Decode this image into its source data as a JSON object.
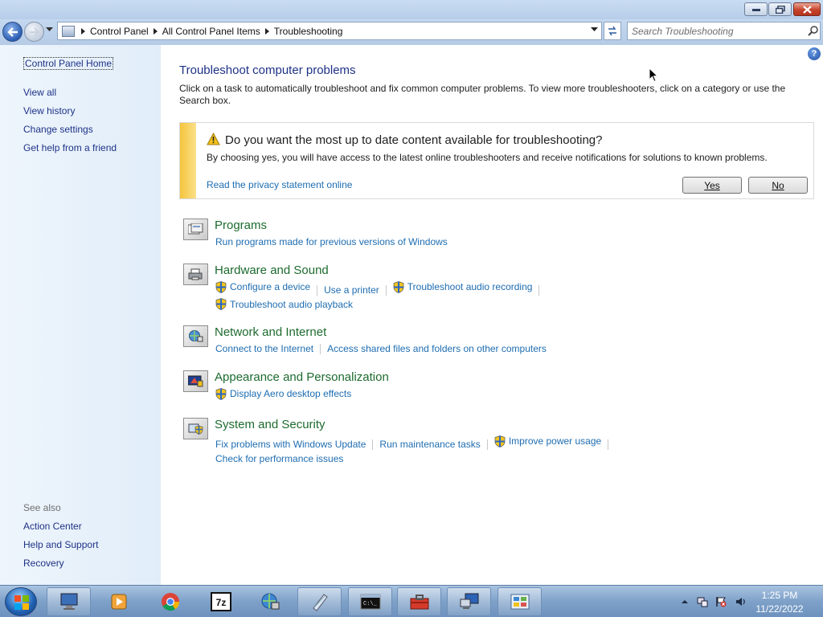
{
  "window": {
    "minimize_icon": "minimize-icon",
    "maximize_icon": "restore-icon",
    "close_icon": "close-icon"
  },
  "address": {
    "crumbs": [
      "Control Panel",
      "All Control Panel Items",
      "Troubleshooting"
    ],
    "search_placeholder": "Search Troubleshooting"
  },
  "sidebar": {
    "home": "Control Panel Home",
    "links": [
      "View all",
      "View history",
      "Change settings",
      "Get help from a friend"
    ],
    "see_also_heading": "See also",
    "see_also": [
      "Action Center",
      "Help and Support",
      "Recovery"
    ]
  },
  "main": {
    "title": "Troubleshoot computer problems",
    "description": "Click on a task to automatically troubleshoot and fix common computer problems. To view more troubleshooters, click on a category or use the Search box.",
    "banner": {
      "title": "Do you want the most up to date content available for troubleshooting?",
      "text": "By choosing yes, you will have access to the latest online troubleshooters and receive notifications for solutions to known problems.",
      "link": "Read the privacy statement online",
      "yes": "Yes",
      "no": "No",
      "accent_color": "#f5c43c"
    },
    "categories": [
      {
        "title": "Programs",
        "icon": "programs-icon",
        "links": [
          "Run programs made for previous versions of Windows"
        ]
      },
      {
        "title": "Hardware and Sound",
        "icon": "hardware-sound-icon",
        "links": [
          "Configure a device",
          "Use a printer",
          "Troubleshoot audio recording",
          "Troubleshoot audio playback"
        ]
      },
      {
        "title": "Network and Internet",
        "icon": "network-icon",
        "links": [
          "Connect to the Internet",
          "Access shared files and folders on other computers"
        ]
      },
      {
        "title": "Appearance and Personalization",
        "icon": "appearance-icon",
        "links": [
          "Display Aero desktop effects"
        ]
      },
      {
        "title": "System and Security",
        "icon": "system-security-icon",
        "links": [
          "Fix problems with Windows Update",
          "Run maintenance tasks",
          "Improve power usage",
          "Check for performance issues"
        ]
      }
    ],
    "category_color": "#1d6b2e",
    "link_color": "#1e6db1"
  },
  "taskbar": {
    "items": [
      "computer-icon",
      "media-player-icon",
      "chrome-icon",
      "7zip-icon",
      "network-globe-icon",
      "notepad-icon",
      "terminal-icon",
      "toolbox-icon",
      "remote-desktop-icon",
      "control-panel-icon"
    ],
    "clock_time": "1:25 PM",
    "clock_date": "11/22/2022"
  }
}
